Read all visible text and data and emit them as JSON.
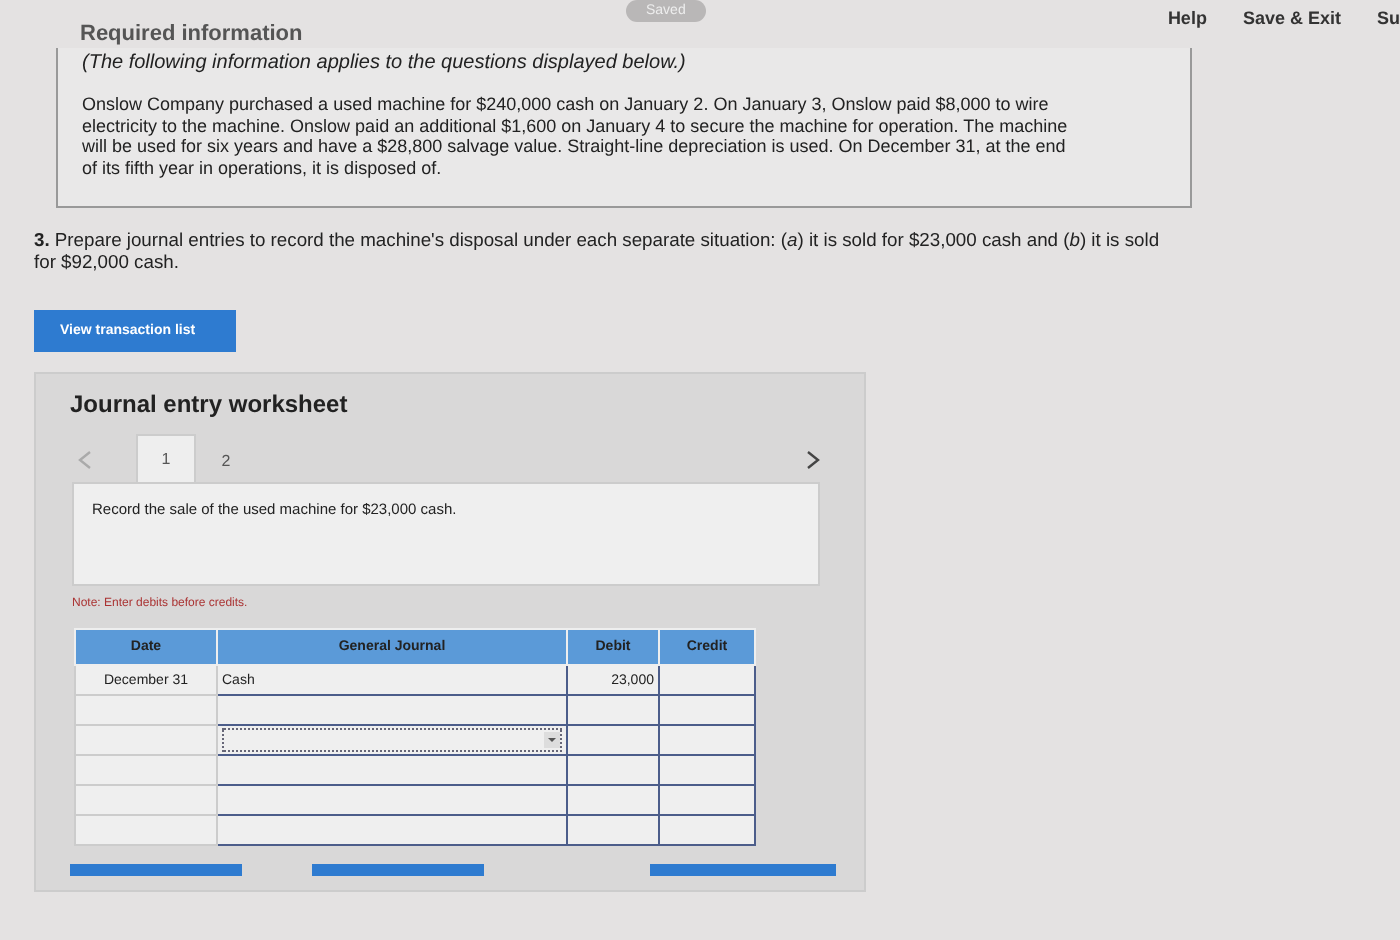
{
  "header": {
    "section_title": "Required information",
    "saved_badge": "Saved",
    "links": [
      "Help",
      "Save & Exit",
      "Su"
    ]
  },
  "info_box": {
    "note": "(The following information applies to the questions displayed below.)",
    "paragraph": "Onslow Company purchased a used machine for $240,000 cash on January 2. On January 3, Onslow paid $8,000 to wire electricity to the machine. Onslow paid an additional $1,600 on January 4 to secure the machine for operation. The machine will be used for six years and have a $28,800 salvage value. Straight-line depreciation is used. On December 31, at the end of its fifth year in operations, it is disposed of."
  },
  "question": {
    "text": "**3.** Prepare journal entries to record the machine's disposal under each separate situation: (*a*) it is sold for $23,000 cash and (*b*) it is sold for $92,000 cash."
  },
  "view_button": "View transaction list",
  "worksheet": {
    "title": "Journal entry worksheet",
    "tabs": [
      {
        "label": "1",
        "selected": true
      },
      {
        "label": "2",
        "selected": false
      }
    ],
    "instruction": "Record the sale of the used machine for $23,000 cash.",
    "note": "Note: Enter debits before credits.",
    "columns": [
      "Date",
      "General Journal",
      "Debit",
      "Credit"
    ],
    "rows": [
      {
        "date": "December 31",
        "account": "Cash",
        "debit": "23,000",
        "kind": "text"
      },
      {
        "kind": "text"
      },
      {
        "kind": "select"
      },
      {
        "kind": "text"
      },
      {
        "kind": "text"
      },
      {
        "kind": "text"
      }
    ]
  }
}
